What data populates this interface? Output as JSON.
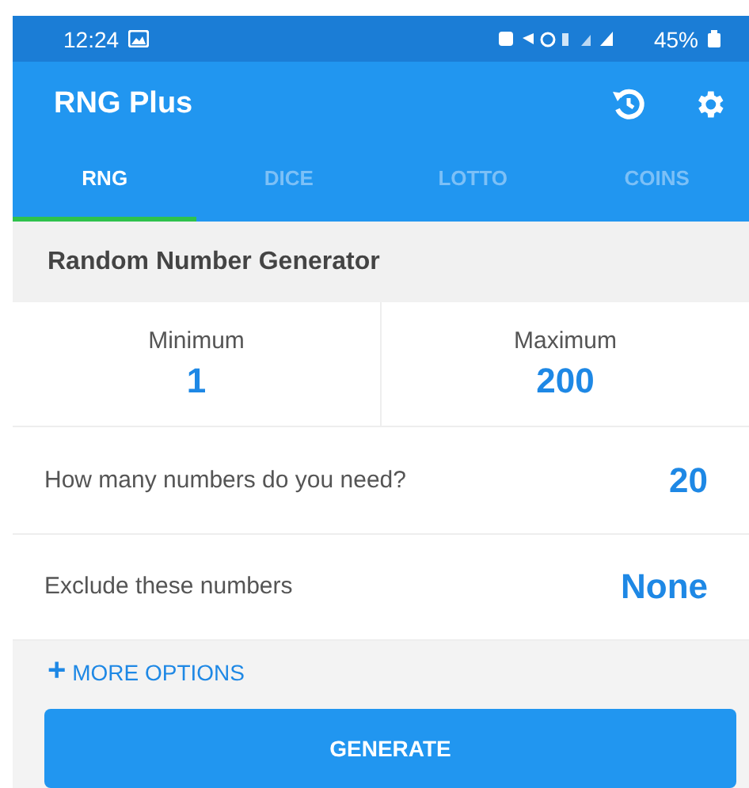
{
  "status_bar": {
    "time": "12:24",
    "battery": "45%"
  },
  "app_bar": {
    "title": "RNG Plus"
  },
  "tabs": [
    {
      "label": "RNG",
      "selected": true
    },
    {
      "label": "DICE",
      "selected": false
    },
    {
      "label": "LOTTO",
      "selected": false
    },
    {
      "label": "COINS",
      "selected": false
    }
  ],
  "section_title": "Random Number Generator",
  "range": [
    {
      "label": "Minimum",
      "value": "1"
    },
    {
      "label": "Maximum",
      "value": "200"
    }
  ],
  "settings": [
    {
      "label": "How many numbers do you need?",
      "value": "20"
    },
    {
      "label": "Exclude these numbers",
      "value": "None"
    }
  ],
  "more_options": {
    "icon": "+",
    "label": "MORE OPTIONS"
  },
  "generate_button": "GENERATE"
}
